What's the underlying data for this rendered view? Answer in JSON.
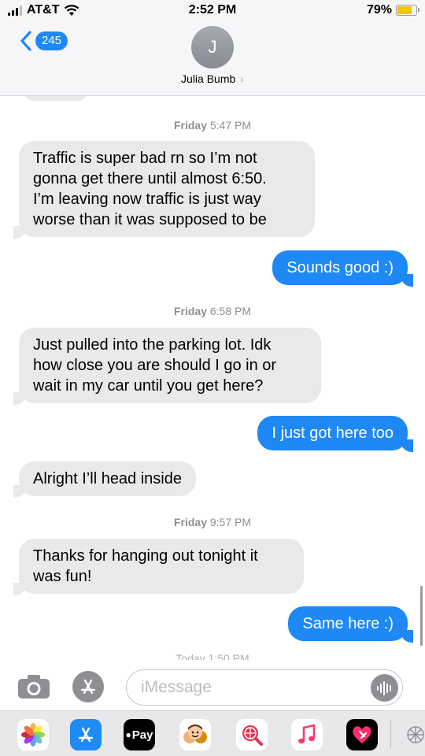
{
  "status_bar": {
    "carrier": "AT&T",
    "time": "2:52 PM",
    "battery_percent": "79%",
    "battery_level": 0.79,
    "signal_bars": 3,
    "icons": [
      "signal-icon",
      "wifi-icon",
      "battery-icon"
    ]
  },
  "header": {
    "back_count": "245",
    "avatar_initial": "J",
    "contact_name": "Julia Bumb",
    "contact_chevron": "›"
  },
  "thread": {
    "ts1": {
      "day": "Friday",
      "time": "5:47 PM"
    },
    "msg1": {
      "line1": "Traffic is super bad rn so I’m not",
      "line2": "gonna get there until almost 6:50.",
      "line3": "I’m leaving now traffic is just way",
      "line4": "worse than it was supposed to be"
    },
    "msg2": "Sounds good :)",
    "ts2": {
      "day": "Friday",
      "time": "6:58 PM"
    },
    "msg3": {
      "line1": "Just pulled into the parking lot. Idk",
      "line2": "how close you are should I go in or",
      "line3": "wait in my car until you get here?"
    },
    "msg4": "I just got here too",
    "msg5": "Alright I’ll head inside",
    "ts3": {
      "day": "Friday",
      "time": "9:57 PM"
    },
    "msg6": {
      "line1": "Thanks for hanging out tonight it",
      "line2": "was fun!"
    },
    "msg7": "Same here :)",
    "ts4_partial": "Today 1:50 PM"
  },
  "input_bar": {
    "placeholder": "iMessage",
    "icons": [
      "camera-icon",
      "app-store-icon",
      "audio-message-icon"
    ]
  },
  "app_drawer": {
    "apple_pay_label": "Pay",
    "apps": [
      "photos-app-icon",
      "app-store-app-icon",
      "apple-pay-app-icon",
      "memoji-app-icon",
      "web-search-app-icon",
      "music-app-icon",
      "digital-touch-app-icon",
      "more-apps-icon"
    ]
  },
  "colors": {
    "sent_bubble": "#1e88f5",
    "received_bubble": "#e9e9eb",
    "header_bg": "#f6f6f8",
    "battery_fill": "#f2c500"
  }
}
